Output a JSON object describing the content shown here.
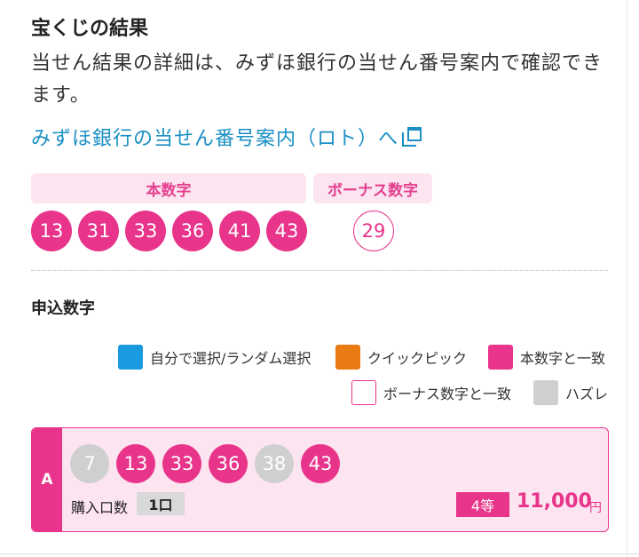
{
  "header": {
    "title": "宝くじの結果",
    "description": "当せん結果の詳細は、みずほ銀行の当せん番号案内で確認できます。",
    "link_text": "みずほ銀行の当せん番号案内（ロト）へ"
  },
  "draw": {
    "main_label": "本数字",
    "bonus_label": "ボーナス数字",
    "main_numbers": [
      "13",
      "31",
      "33",
      "36",
      "41",
      "43"
    ],
    "bonus_number": "29"
  },
  "entries_title": "申込数字",
  "legend": [
    {
      "label": "自分で選択/ランダム選択",
      "color": "#1a9ae0"
    },
    {
      "label": "クイックピック",
      "color": "#ea7a12"
    },
    {
      "label": "本数字と一致",
      "color": "#e8348a"
    },
    {
      "label": "ボーナス数字と一致",
      "color": "#ffffff"
    },
    {
      "label": "ハズレ",
      "color": "#cfcfcf"
    }
  ],
  "entry": {
    "letter": "A",
    "numbers": [
      {
        "value": "7",
        "status": "miss"
      },
      {
        "value": "13",
        "status": "match"
      },
      {
        "value": "33",
        "status": "match"
      },
      {
        "value": "36",
        "status": "match"
      },
      {
        "value": "38",
        "status": "miss"
      },
      {
        "value": "43",
        "status": "match"
      }
    ],
    "qty_label": "購入口数",
    "qty_value": "1口",
    "rank": "4等",
    "amount": "11,000",
    "currency": "円"
  }
}
